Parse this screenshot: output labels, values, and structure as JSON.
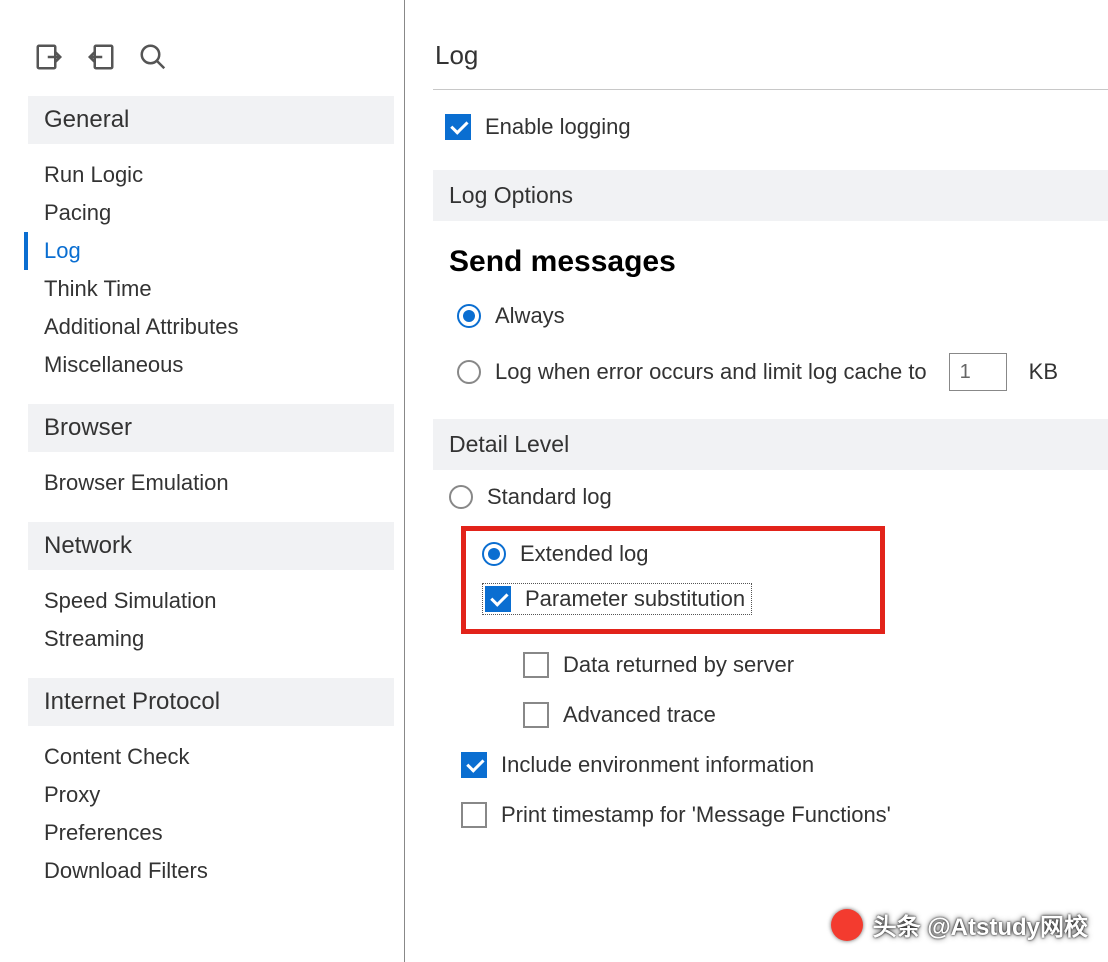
{
  "sidebar": {
    "sections": [
      {
        "title": "General",
        "items": [
          "Run Logic",
          "Pacing",
          "Log",
          "Think Time",
          "Additional Attributes",
          "Miscellaneous"
        ],
        "active_index": 2
      },
      {
        "title": "Browser",
        "items": [
          "Browser Emulation"
        ]
      },
      {
        "title": "Network",
        "items": [
          "Speed Simulation",
          "Streaming"
        ]
      },
      {
        "title": "Internet Protocol",
        "items": [
          "Content Check",
          "Proxy",
          "Preferences",
          "Download Filters"
        ]
      }
    ]
  },
  "main": {
    "title": "Log",
    "enable_logging": {
      "label": "Enable logging",
      "checked": true
    },
    "log_options": {
      "header": "Log Options",
      "subtitle": "Send messages",
      "options": [
        {
          "label": "Always",
          "selected": true
        },
        {
          "label": "Log when error occurs and limit log cache to",
          "selected": false,
          "input_value": "1",
          "unit": "KB"
        }
      ]
    },
    "detail_level": {
      "header": "Detail Level",
      "options": {
        "standard": {
          "label": "Standard log",
          "selected": false
        },
        "extended": {
          "label": "Extended log",
          "selected": true,
          "children": [
            {
              "label": "Parameter substitution",
              "checked": true,
              "highlight": true
            },
            {
              "label": "Data returned by server",
              "checked": false
            },
            {
              "label": "Advanced trace",
              "checked": false
            }
          ]
        },
        "include_env": {
          "label": "Include environment information",
          "checked": true
        },
        "print_ts": {
          "label": "Print timestamp for 'Message Functions'",
          "checked": false
        }
      }
    }
  },
  "watermark": "头条 @Atstudy网校"
}
